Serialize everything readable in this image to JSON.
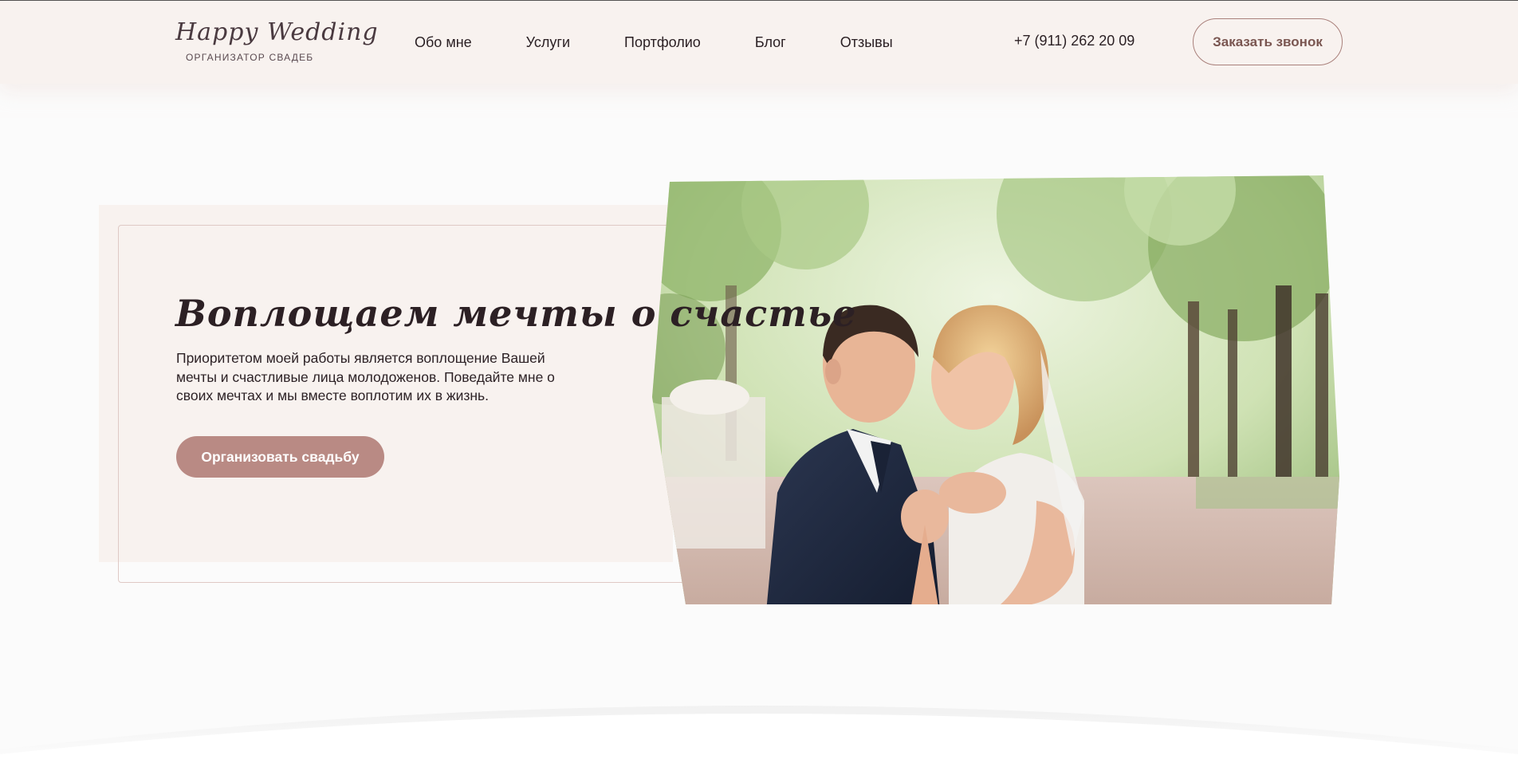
{
  "logo": {
    "script": "Happy Wedding",
    "subtitle": "ОРГАНИЗАТОР СВАДЕБ"
  },
  "nav": {
    "items": [
      {
        "label": "Обо мне"
      },
      {
        "label": "Услуги"
      },
      {
        "label": "Портфолио"
      },
      {
        "label": "Блог"
      },
      {
        "label": "Отзывы"
      }
    ]
  },
  "header": {
    "phone": "+7 (911) 262 20 09",
    "callback_label": "Заказать звонок"
  },
  "hero": {
    "title": "Воплощаем мечты о счастье",
    "text": "Приоритетом моей работы является воплощение Вашей мечты и счастливые лица молодоженов. Поведайте мне о своих мечтах и мы вместе воплотим их в жизнь.",
    "cta_label": "Организовать свадьбу"
  },
  "colors": {
    "header_bg": "#f8f2ef",
    "accent": "#b98a84",
    "accent_dark": "#7a5651",
    "text": "#2d2226"
  }
}
